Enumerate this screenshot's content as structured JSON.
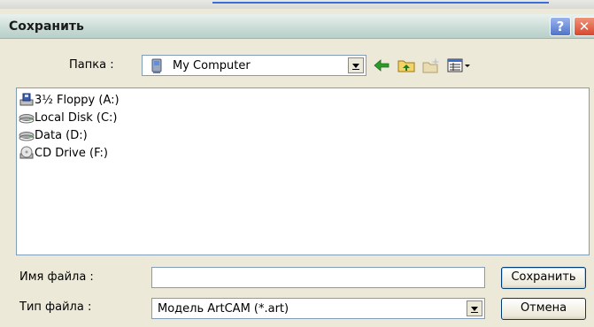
{
  "window": {
    "title": "Сохранить",
    "help_glyph": "?",
    "close_glyph": "✕"
  },
  "folder": {
    "label": "Папка :",
    "value": "My Computer"
  },
  "toolbar": {
    "icons": [
      "back-arrow-icon",
      "up-folder-icon",
      "new-folder-icon",
      "view-menu-icon"
    ]
  },
  "files": [
    {
      "name": "3½ Floppy (A:)",
      "icon": "floppy-drive-icon"
    },
    {
      "name": "Local Disk (C:)",
      "icon": "hard-disk-icon"
    },
    {
      "name": "Data (D:)",
      "icon": "hard-disk-icon"
    },
    {
      "name": "CD Drive (F:)",
      "icon": "cd-drive-icon"
    }
  ],
  "filename": {
    "label": "Имя файла :",
    "value": ""
  },
  "filetype": {
    "label": "Тип файла :",
    "value": "Модель ArtCAM (*.art)"
  },
  "buttons": {
    "save": "Сохранить",
    "cancel": "Отмена"
  },
  "colors": {
    "title_bar": "#c9dbd6",
    "dialog_bg": "#ece9d8",
    "border": "#7f9db9",
    "button_border": "#003c74"
  }
}
